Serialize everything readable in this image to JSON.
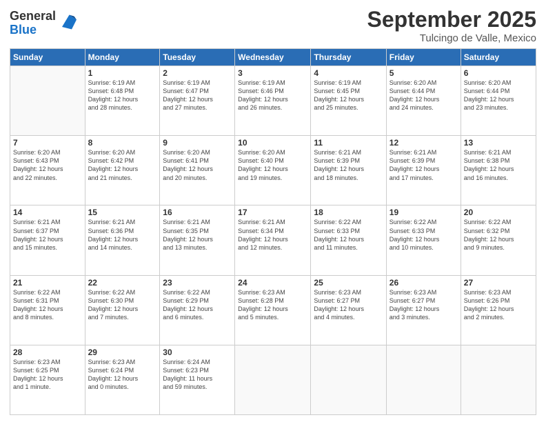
{
  "header": {
    "logo_general": "General",
    "logo_blue": "Blue",
    "month_title": "September 2025",
    "location": "Tulcingo de Valle, Mexico"
  },
  "weekdays": [
    "Sunday",
    "Monday",
    "Tuesday",
    "Wednesday",
    "Thursday",
    "Friday",
    "Saturday"
  ],
  "weeks": [
    [
      {
        "day": "",
        "info": ""
      },
      {
        "day": "1",
        "info": "Sunrise: 6:19 AM\nSunset: 6:48 PM\nDaylight: 12 hours\nand 28 minutes."
      },
      {
        "day": "2",
        "info": "Sunrise: 6:19 AM\nSunset: 6:47 PM\nDaylight: 12 hours\nand 27 minutes."
      },
      {
        "day": "3",
        "info": "Sunrise: 6:19 AM\nSunset: 6:46 PM\nDaylight: 12 hours\nand 26 minutes."
      },
      {
        "day": "4",
        "info": "Sunrise: 6:19 AM\nSunset: 6:45 PM\nDaylight: 12 hours\nand 25 minutes."
      },
      {
        "day": "5",
        "info": "Sunrise: 6:20 AM\nSunset: 6:44 PM\nDaylight: 12 hours\nand 24 minutes."
      },
      {
        "day": "6",
        "info": "Sunrise: 6:20 AM\nSunset: 6:44 PM\nDaylight: 12 hours\nand 23 minutes."
      }
    ],
    [
      {
        "day": "7",
        "info": "Sunrise: 6:20 AM\nSunset: 6:43 PM\nDaylight: 12 hours\nand 22 minutes."
      },
      {
        "day": "8",
        "info": "Sunrise: 6:20 AM\nSunset: 6:42 PM\nDaylight: 12 hours\nand 21 minutes."
      },
      {
        "day": "9",
        "info": "Sunrise: 6:20 AM\nSunset: 6:41 PM\nDaylight: 12 hours\nand 20 minutes."
      },
      {
        "day": "10",
        "info": "Sunrise: 6:20 AM\nSunset: 6:40 PM\nDaylight: 12 hours\nand 19 minutes."
      },
      {
        "day": "11",
        "info": "Sunrise: 6:21 AM\nSunset: 6:39 PM\nDaylight: 12 hours\nand 18 minutes."
      },
      {
        "day": "12",
        "info": "Sunrise: 6:21 AM\nSunset: 6:39 PM\nDaylight: 12 hours\nand 17 minutes."
      },
      {
        "day": "13",
        "info": "Sunrise: 6:21 AM\nSunset: 6:38 PM\nDaylight: 12 hours\nand 16 minutes."
      }
    ],
    [
      {
        "day": "14",
        "info": "Sunrise: 6:21 AM\nSunset: 6:37 PM\nDaylight: 12 hours\nand 15 minutes."
      },
      {
        "day": "15",
        "info": "Sunrise: 6:21 AM\nSunset: 6:36 PM\nDaylight: 12 hours\nand 14 minutes."
      },
      {
        "day": "16",
        "info": "Sunrise: 6:21 AM\nSunset: 6:35 PM\nDaylight: 12 hours\nand 13 minutes."
      },
      {
        "day": "17",
        "info": "Sunrise: 6:21 AM\nSunset: 6:34 PM\nDaylight: 12 hours\nand 12 minutes."
      },
      {
        "day": "18",
        "info": "Sunrise: 6:22 AM\nSunset: 6:33 PM\nDaylight: 12 hours\nand 11 minutes."
      },
      {
        "day": "19",
        "info": "Sunrise: 6:22 AM\nSunset: 6:33 PM\nDaylight: 12 hours\nand 10 minutes."
      },
      {
        "day": "20",
        "info": "Sunrise: 6:22 AM\nSunset: 6:32 PM\nDaylight: 12 hours\nand 9 minutes."
      }
    ],
    [
      {
        "day": "21",
        "info": "Sunrise: 6:22 AM\nSunset: 6:31 PM\nDaylight: 12 hours\nand 8 minutes."
      },
      {
        "day": "22",
        "info": "Sunrise: 6:22 AM\nSunset: 6:30 PM\nDaylight: 12 hours\nand 7 minutes."
      },
      {
        "day": "23",
        "info": "Sunrise: 6:22 AM\nSunset: 6:29 PM\nDaylight: 12 hours\nand 6 minutes."
      },
      {
        "day": "24",
        "info": "Sunrise: 6:23 AM\nSunset: 6:28 PM\nDaylight: 12 hours\nand 5 minutes."
      },
      {
        "day": "25",
        "info": "Sunrise: 6:23 AM\nSunset: 6:27 PM\nDaylight: 12 hours\nand 4 minutes."
      },
      {
        "day": "26",
        "info": "Sunrise: 6:23 AM\nSunset: 6:27 PM\nDaylight: 12 hours\nand 3 minutes."
      },
      {
        "day": "27",
        "info": "Sunrise: 6:23 AM\nSunset: 6:26 PM\nDaylight: 12 hours\nand 2 minutes."
      }
    ],
    [
      {
        "day": "28",
        "info": "Sunrise: 6:23 AM\nSunset: 6:25 PM\nDaylight: 12 hours\nand 1 minute."
      },
      {
        "day": "29",
        "info": "Sunrise: 6:23 AM\nSunset: 6:24 PM\nDaylight: 12 hours\nand 0 minutes."
      },
      {
        "day": "30",
        "info": "Sunrise: 6:24 AM\nSunset: 6:23 PM\nDaylight: 11 hours\nand 59 minutes."
      },
      {
        "day": "",
        "info": ""
      },
      {
        "day": "",
        "info": ""
      },
      {
        "day": "",
        "info": ""
      },
      {
        "day": "",
        "info": ""
      }
    ]
  ]
}
